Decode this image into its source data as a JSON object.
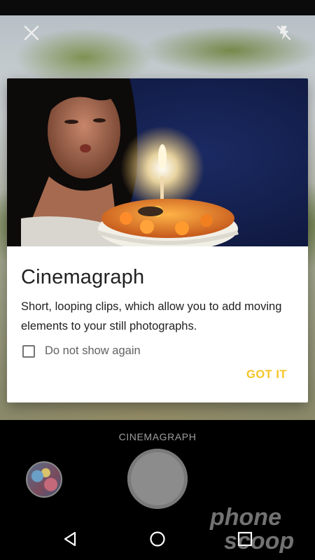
{
  "toolbar": {
    "close_icon": "close-icon",
    "flash_icon": "flash-off-icon"
  },
  "dialog": {
    "title": "Cinemagraph",
    "body": "Short, looping clips, which allow you to add moving elements to your still photographs.",
    "checkbox_label": "Do not show again",
    "checkbox_checked": false,
    "confirm_label": "GOT IT",
    "confirm_color": "#f6c526"
  },
  "camera": {
    "mode_label": "CINEMAGRAPH"
  },
  "navbar": {
    "back_icon": "back-icon",
    "home_icon": "home-icon",
    "recents_icon": "recents-icon"
  },
  "watermark": {
    "text_line1": "phone",
    "text_line2": "scoop"
  }
}
